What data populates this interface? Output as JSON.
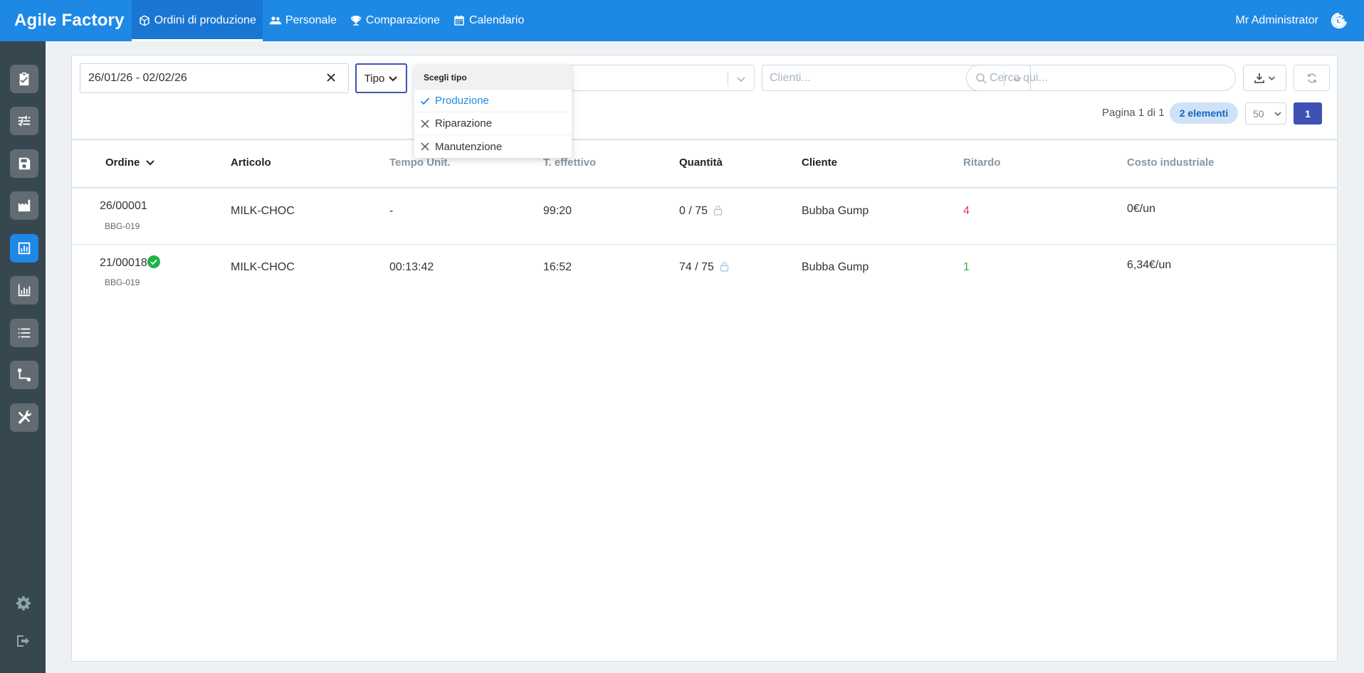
{
  "app": {
    "brand": "Agile Factory",
    "nav": [
      {
        "label": "Ordini di produzione",
        "icon": "box-icon",
        "active": true
      },
      {
        "label": "Personale",
        "icon": "users-icon"
      },
      {
        "label": "Comparazione",
        "icon": "trophy-icon"
      },
      {
        "label": "Calendario",
        "icon": "calendar-icon"
      }
    ],
    "user": "Mr Administrator"
  },
  "filters": {
    "date_range": "26/01/26 - 02/02/26",
    "tipo_label": "Tipo",
    "clienti_placeholder": "Clienti...",
    "search_placeholder": "Cerca qui..."
  },
  "dropdown": {
    "header": "Scegli tipo",
    "options": [
      {
        "label": "Produzione",
        "selected": true
      },
      {
        "label": "Riparazione",
        "selected": false
      },
      {
        "label": "Manutenzione",
        "selected": false
      }
    ]
  },
  "pagination": {
    "text": "Pagina 1 di 1",
    "count": "2 elementi",
    "page_size": "50",
    "current_page": "1"
  },
  "table": {
    "headers": [
      "Ordine",
      "Articolo",
      "Tempo Unit.",
      "T. effettivo",
      "Quantità",
      "Cliente",
      "Ritardo",
      "Costo industriale"
    ],
    "rows": [
      {
        "order": "26/00001",
        "code": "BBG-019",
        "article": "MILK-CHOC",
        "unit_time": "-",
        "actual_time": "99:20",
        "quantity": "0 / 75",
        "client": "Bubba Gump",
        "delay": "4",
        "delay_color": "#e53950",
        "cost": "0€/un",
        "completed": false
      },
      {
        "order": "21/00018",
        "code": "BBG-019",
        "article": "MILK-CHOC",
        "unit_time": "00:13:42",
        "actual_time": "16:52",
        "quantity": "74 / 75",
        "client": "Bubba Gump",
        "delay": "1",
        "delay_color": "#2eb24b",
        "cost": "6,34€/un",
        "completed": true
      }
    ]
  },
  "colors": {
    "primary": "#1e88e5",
    "sidebar": "#37474f",
    "accent": "#3f51b5"
  }
}
